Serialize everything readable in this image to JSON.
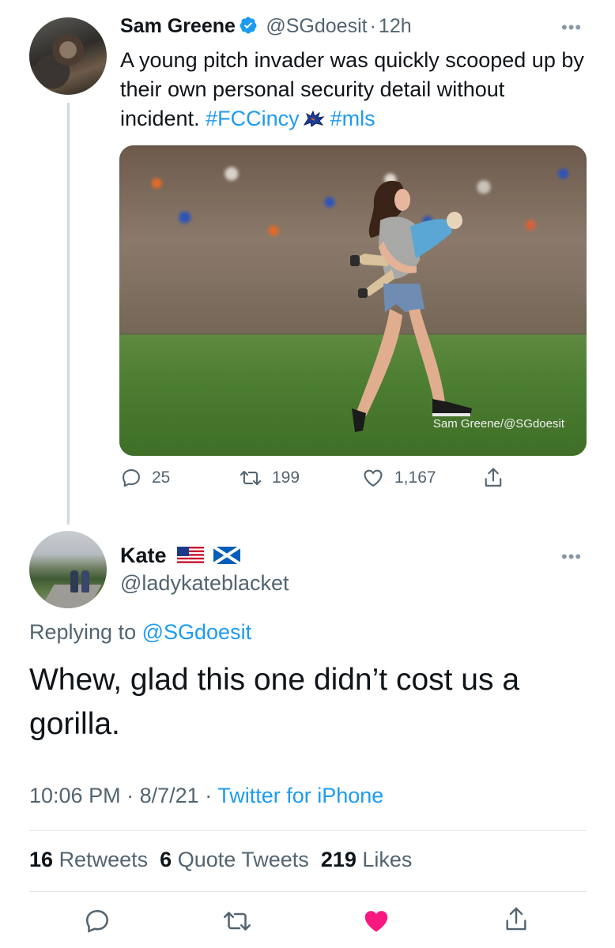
{
  "parent_tweet": {
    "author_name": "Sam Greene",
    "verified_icon": "verified-badge-icon",
    "handle": "@SGdoesit",
    "separator": "·",
    "time_ago": "12h",
    "text_part1": "A young pitch invader was quickly scooped up by their own personal security detail without incident. ",
    "hashtag1": "#FCCincy",
    "hashtag2": "#mls",
    "media_watermark": "Sam Greene/@SGdoesit",
    "actions": {
      "replies": "25",
      "retweets": "199",
      "likes": "1,167"
    }
  },
  "reply_tweet": {
    "author_name": "Kate",
    "handle": "@ladykateblacket",
    "replying_prefix": "Replying to",
    "replying_to": "@SGdoesit",
    "text": "Whew, glad this one didn’t cost us a gorilla.",
    "time": "10:06 PM",
    "separator": "·",
    "date": "8/7/21",
    "source": "Twitter for iPhone",
    "stats": {
      "retweets_count": "16",
      "retweets_label": "Retweets",
      "quotes_count": "6",
      "quotes_label": "Quote Tweets",
      "likes_count": "219",
      "likes_label": "Likes"
    }
  },
  "colors": {
    "accent": "#1d9bf0",
    "like_active": "#f91880",
    "secondary_text": "#536471",
    "icon_gray": "#536471"
  }
}
